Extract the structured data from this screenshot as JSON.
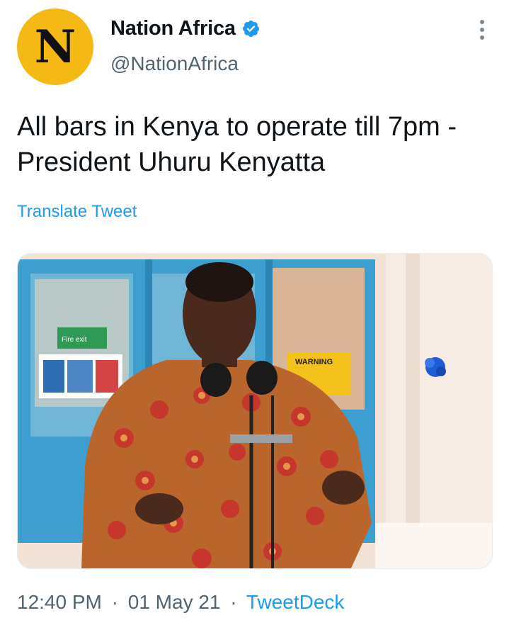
{
  "author": {
    "avatar_letter": "N",
    "avatar_color": "#f5b915",
    "display_name": "Nation Africa",
    "handle": "@NationAfrica",
    "verified_icon": "verified-badge-icon"
  },
  "menu": {
    "icon": "more-vertical-icon"
  },
  "tweet": {
    "text": "All bars in Kenya to operate till 7pm - President Uhuru Kenyatta",
    "translate_label": "Translate Tweet"
  },
  "media": {
    "warning_sign": "WARNING",
    "exit_sign": "Fire exit"
  },
  "meta": {
    "time": "12:40 PM",
    "separator": "·",
    "date": "01 May 21",
    "source": "TweetDeck"
  },
  "colors": {
    "link": "#1d9bf0",
    "secondary_text": "#536471",
    "primary_text": "#0f1419"
  }
}
